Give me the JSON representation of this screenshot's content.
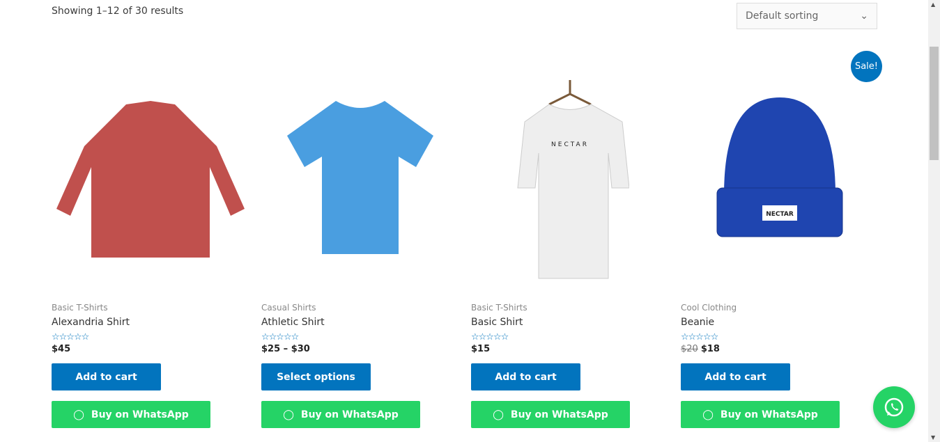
{
  "result_count": "Showing 1–12 of 30 results",
  "sorting": {
    "selected": "Default sorting"
  },
  "sale_badge": "Sale!",
  "products": [
    {
      "category": "Basic T-Shirts",
      "name": "Alexandria Shirt",
      "price": "$45",
      "old_price": "",
      "button": "Add to cart",
      "whatsapp": "Buy on WhatsApp",
      "color": "#c0504d",
      "rating": 0
    },
    {
      "category": "Casual Shirts",
      "name": "Athletic Shirt",
      "price": "$25 – $30",
      "old_price": "",
      "button": "Select options",
      "whatsapp": "Buy on WhatsApp",
      "color": "#4a9ee0",
      "rating": 0
    },
    {
      "category": "Basic T-Shirts",
      "name": "Basic Shirt",
      "price": "$15",
      "old_price": "",
      "button": "Add to cart",
      "whatsapp": "Buy on WhatsApp",
      "color": "#eeeeee",
      "rating": 0
    },
    {
      "category": "Cool Clothing",
      "name": "Beanie",
      "price": "$18",
      "old_price": "$20",
      "button": "Add to cart",
      "whatsapp": "Buy on WhatsApp",
      "color": "#1f45b0",
      "rating": 0
    }
  ],
  "print_labels": {
    "nectar": "NECTAR"
  },
  "colors": {
    "primary": "#0274be",
    "whatsapp": "#25d366"
  }
}
